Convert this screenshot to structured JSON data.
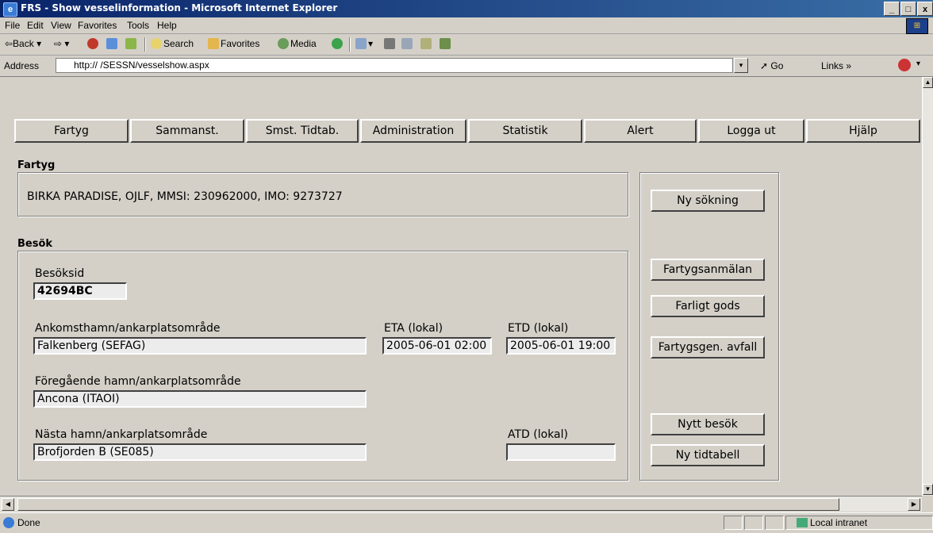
{
  "window": {
    "title": "FRS - Show vesselinformation - Microsoft Internet Explorer",
    "minimize": "_",
    "maximize": "□",
    "close": "x"
  },
  "menu": [
    "File",
    "Edit",
    "View",
    "Favorites",
    "Tools",
    "Help"
  ],
  "toolbar": {
    "back": "⇦Back ▾",
    "forward": "⇨ ▾",
    "search": "Search",
    "favorites": "Favorites",
    "media": "Media",
    "history_dd": "▾"
  },
  "address": {
    "label": "Address",
    "url": "http://  /SESSN/vesselshow.aspx",
    "go": "Go",
    "links": "Links »",
    "dropdown": "▾"
  },
  "nav": [
    "Fartyg",
    "Sammanst.",
    "Smst. Tidtab.",
    "Administration",
    "Statistik",
    "Alert",
    "Logga ut",
    "Hjälp"
  ],
  "vessel": {
    "heading": "Fartyg",
    "info": "BIRKA PARADISE, OJLF, MMSI: 230962000, IMO: 9273727"
  },
  "visit": {
    "heading": "Besök",
    "id_label": "Besöksid",
    "id_value": "42694BC",
    "arrival_label": "Ankomsthamn/ankarplatsområde",
    "arrival_value": "Falkenberg (SEFAG)",
    "eta_label": "ETA (lokal)",
    "eta_value": "2005-06-01 02:00",
    "etd_label": "ETD (lokal)",
    "etd_value": "2005-06-01 19:00",
    "prev_label": "Föregående hamn/ankarplatsområde",
    "prev_value": "Ancona (ITAOI)",
    "next_label": "Nästa hamn/ankarplatsområde",
    "next_value": "Brofjorden B (SE085)",
    "atd_label": "ATD (lokal)",
    "atd_value": ""
  },
  "side_buttons": {
    "new_search": "Ny sökning",
    "notification": "Fartygsanmälan",
    "dangerous_goods": "Farligt gods",
    "waste": "Fartygsgen. avfall",
    "new_visit": "Nytt besök",
    "new_timetable": "Ny tidtabell"
  },
  "status": {
    "text": "Done",
    "zone": "Local intranet"
  },
  "colors": {
    "titlebar_start": "#0a246a",
    "titlebar_end": "#3a6ea5",
    "face": "#d4d0c8"
  }
}
